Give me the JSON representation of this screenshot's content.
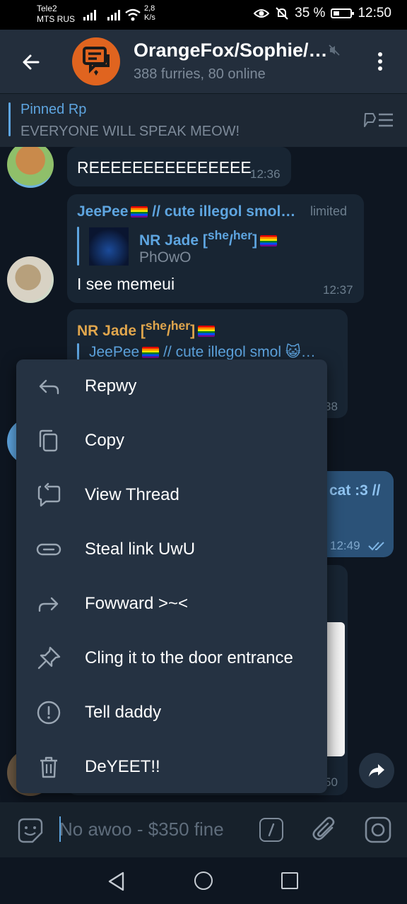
{
  "status": {
    "carrier_line1": "Tele2",
    "carrier_line2": "MTS RUS",
    "speed": "2,8",
    "speed_unit": "K/s",
    "battery": "35 %",
    "time": "12:50"
  },
  "header": {
    "title": "OrangeFox/Sophie/…",
    "subtitle": "388 furries, 80 online"
  },
  "pinned": {
    "title": "Pinned Rp",
    "text": "EVERYONE WILL SPEAK MEOW!"
  },
  "messages": [
    {
      "text": "REEEEEEEEEEEEEEE",
      "time": "12:36"
    },
    {
      "sender": "JeePee 🏳️‍🌈 // cute illegol smol…",
      "sender_name": "JeePee",
      "sender_suffix": "// cute illegol smol…",
      "badge": "limited",
      "reply_sender": "NR Jade",
      "reply_sup": "she",
      "reply_sup2": "her",
      "reply_text": "PhOwO",
      "text": "I see memeui",
      "time": "12:37"
    },
    {
      "sender_name": "NR Jade",
      "sender_sup": "she",
      "sender_sup2": "her",
      "reply_sender": "JeePee",
      "reply_suffix": "// cute illegol smol 😺…",
      "time_fragment": "38"
    },
    {
      "text_fragment": "cat :3 //",
      "time": "12:49"
    },
    {
      "time_fragment": "50"
    }
  ],
  "context_menu": {
    "items": [
      {
        "label": "Repwy",
        "icon": "reply-icon"
      },
      {
        "label": "Copy",
        "icon": "copy-icon"
      },
      {
        "label": "View Thread",
        "icon": "thread-icon"
      },
      {
        "label": "Steal link UwU",
        "icon": "link-icon"
      },
      {
        "label": "Fowward >~<",
        "icon": "forward-icon"
      },
      {
        "label": "Cling it to the door entrance",
        "icon": "pin-icon"
      },
      {
        "label": "Tell daddy",
        "icon": "report-icon"
      },
      {
        "label": "DeYEET!!",
        "icon": "delete-icon"
      }
    ]
  },
  "input": {
    "placeholder": "No awoo - $350 fine"
  },
  "colors": {
    "accent": "#5ea5e0",
    "header_bg": "#232e3c",
    "chat_bg": "#0e1621",
    "menu_bg": "#253242",
    "sender_orange": "#e0a64d"
  }
}
